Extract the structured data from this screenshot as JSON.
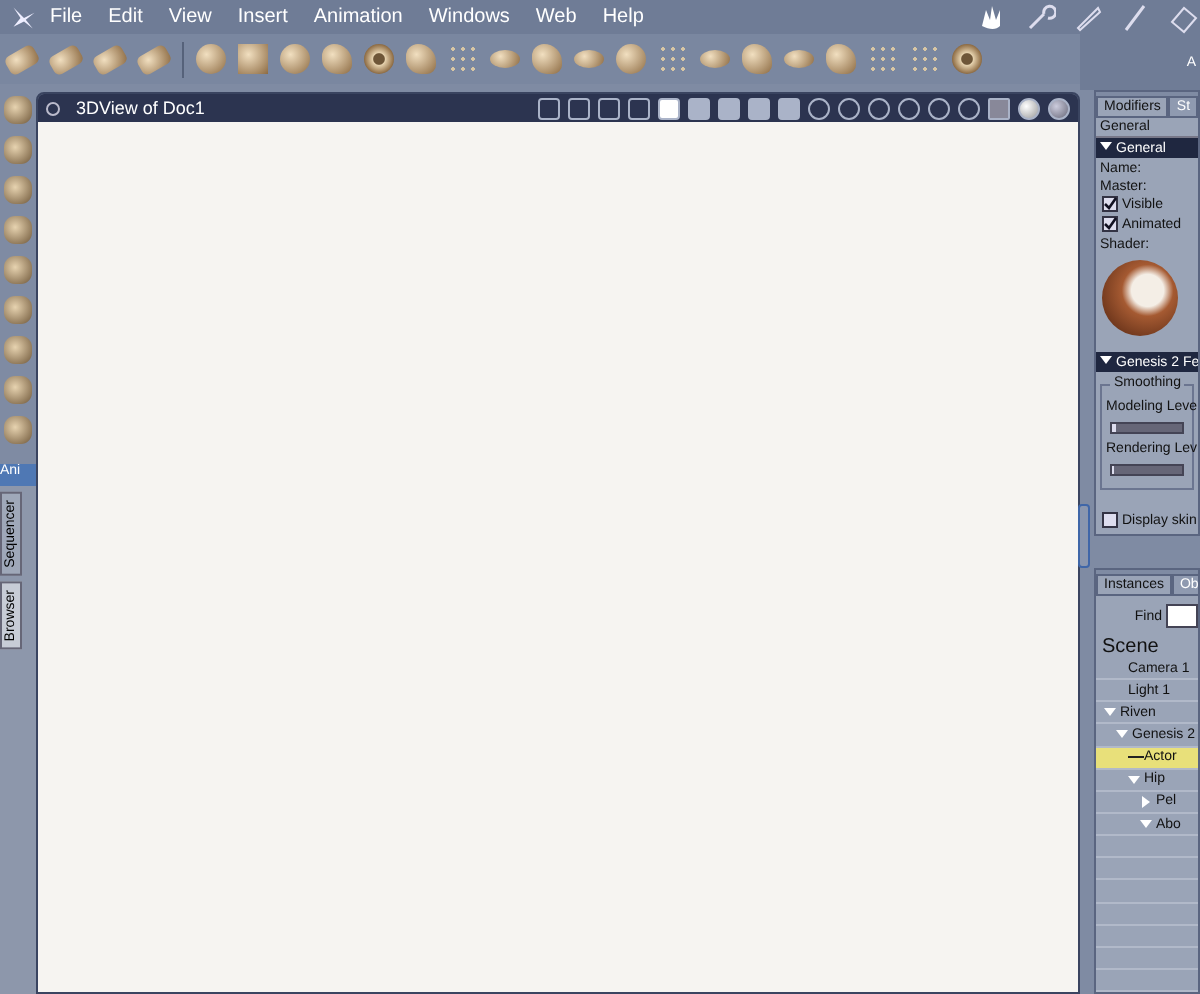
{
  "menu": [
    "File",
    "Edit",
    "View",
    "Insert",
    "Animation",
    "Windows",
    "Web",
    "Help"
  ],
  "viewport": {
    "title": "3DView of Doc1"
  },
  "left_tabs": {
    "header": "Ani",
    "vertical": [
      {
        "label": "Sequencer",
        "selected": false
      },
      {
        "label": "Browser",
        "selected": true
      }
    ]
  },
  "corner_label": "A",
  "modifiers": {
    "tabs": [
      {
        "label": "Modifiers",
        "selected": true
      },
      {
        "label": "St",
        "selected": false
      }
    ],
    "general_caption": "General",
    "section": "General",
    "fields": [
      "Name:",
      "Master:"
    ],
    "checks": [
      {
        "label": "Visible",
        "checked": true
      },
      {
        "label": "Animated",
        "checked": true
      }
    ],
    "shader_label": "Shader:",
    "section2": "Genesis 2 Fe",
    "group": "Smoothing",
    "sliders": [
      {
        "label": "Modeling Leve",
        "level": 0.06
      },
      {
        "label": "Rendering Lev",
        "level": 0.03
      }
    ],
    "display_skin": {
      "label": "Display skin",
      "checked": false
    }
  },
  "instances": {
    "tabs": [
      {
        "label": "Instances",
        "selected": true
      },
      {
        "label": "Ob",
        "selected": false
      }
    ],
    "find_label": "Find",
    "title": "Scene",
    "tree": [
      {
        "label": "Camera 1",
        "selected": false
      },
      {
        "label": "Light 1",
        "selected": false
      },
      {
        "label": "Riven",
        "selected": false,
        "expanded": true,
        "children": [
          {
            "label": "Genesis 2",
            "selected": false,
            "expanded": true,
            "children": [
              {
                "label": "Actor",
                "selected": true
              },
              {
                "label": "Hip",
                "selected": false,
                "expanded": true,
                "children": [
                  {
                    "label": "Pel",
                    "selected": false,
                    "expanded": false
                  },
                  {
                    "label": "Abo",
                    "selected": false,
                    "expanded": true
                  }
                ]
              }
            ]
          }
        ]
      }
    ]
  }
}
